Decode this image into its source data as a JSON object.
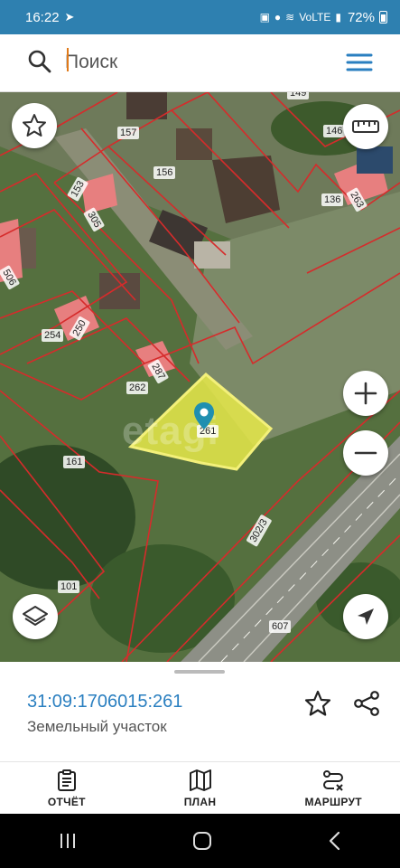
{
  "status_bar": {
    "time": "16:22",
    "network": "VoLTE",
    "battery": "72%"
  },
  "search": {
    "placeholder": "Поиск"
  },
  "map": {
    "parcel_labels": [
      "149",
      "157",
      "146",
      "156",
      "153",
      "305",
      "136",
      "263",
      "506",
      "250",
      "254",
      "287",
      "262",
      "261",
      "161",
      "302/3",
      "101",
      "607"
    ],
    "watermark": "etagi",
    "selected_color": "#e8e94a",
    "boundary_color": "#d62b2b"
  },
  "selected": {
    "cadastral_number": "31:09:1706015:261",
    "type": "Земельный участок"
  },
  "tabs": [
    {
      "label": "ОТЧЁТ",
      "icon": "report-icon"
    },
    {
      "label": "ПЛАН",
      "icon": "map-plan-icon"
    },
    {
      "label": "МАРШРУТ",
      "icon": "route-icon"
    }
  ],
  "colors": {
    "status_bar": "#2e80b0",
    "accent": "#2a7fc0"
  }
}
